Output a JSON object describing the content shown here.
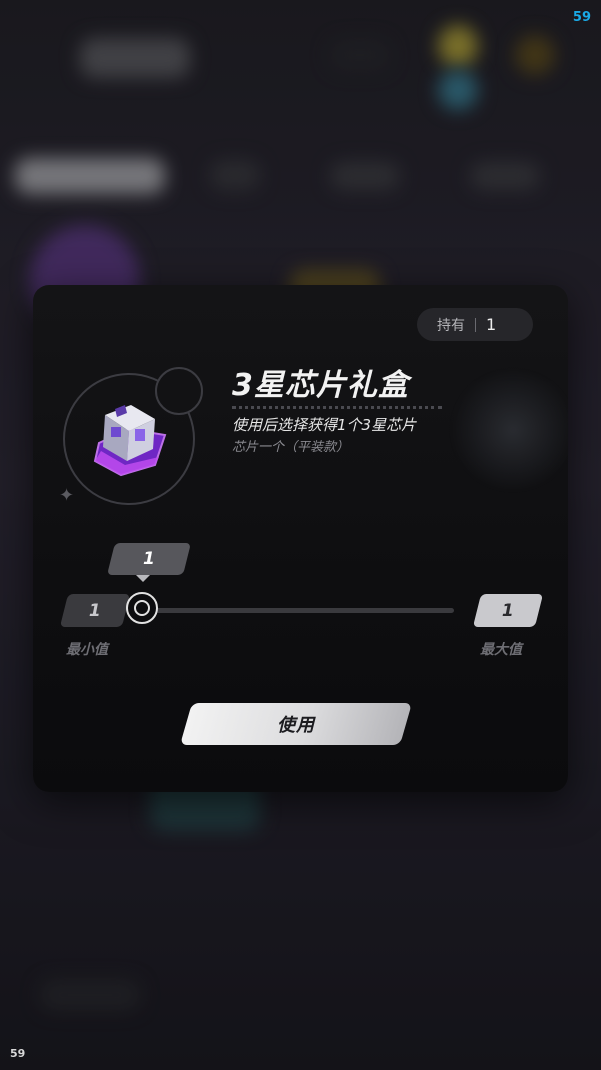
{
  "status": {
    "fps_top": "59",
    "fps_bottom": "59"
  },
  "dialog": {
    "owned_label": "持有",
    "owned_count": "1",
    "item_title": "3星芯片礼盒",
    "item_description": "使用后选择获得1个3星芯片",
    "item_subtitle": "芯片一个（平装款）",
    "item_icon": "purple-chip-gift-box-icon",
    "quantity": {
      "current": "1",
      "min": "1",
      "max": "1",
      "min_label": "最小值",
      "max_label": "最大值"
    },
    "use_button": "使用"
  },
  "colors": {
    "accent": "#e2e2e2",
    "fps": "#1aa9e6",
    "gem": "#9b3cf0"
  }
}
